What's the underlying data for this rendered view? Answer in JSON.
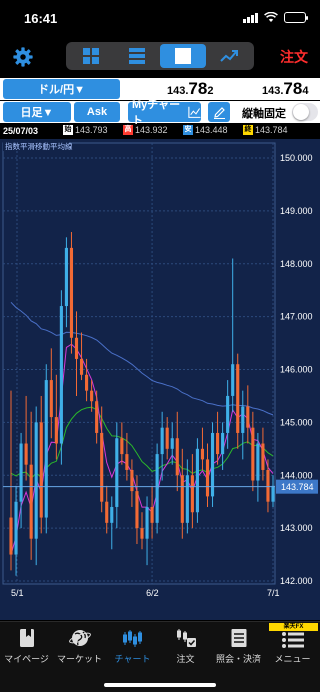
{
  "status": {
    "time": "16:41"
  },
  "toolbar": {
    "order_label": "注文"
  },
  "quote": {
    "pair_label": "ドル/円▼",
    "bid": {
      "main": "143.",
      "big": "78",
      "tail": "2"
    },
    "ask": {
      "main": "143.",
      "big": "78",
      "tail": "4"
    }
  },
  "controls": {
    "timeframe_label": "日足▼",
    "side_label": "Ask",
    "mychart_label": "Myチャート",
    "fix_axis_label": "縦軸固定"
  },
  "ohlc": {
    "date": "25/07/03",
    "open_tag": "始",
    "open": "143.793",
    "high_tag": "高",
    "high": "143.932",
    "low_tag": "安",
    "low": "143.448",
    "close_tag": "終",
    "close": "143.784"
  },
  "chart_data": {
    "type": "candlestick",
    "indicator_label": "指数平滑移動平均線",
    "y_ticks": [
      "150.000",
      "149.000",
      "148.000",
      "147.000",
      "146.000",
      "145.000",
      "144.000",
      "143.000",
      "142.000"
    ],
    "ylim": [
      142.0,
      150.0
    ],
    "x_ticks": [
      "5/1",
      "6/2",
      "7/1"
    ],
    "current_price_label": "143.784",
    "current_price": 143.784,
    "colors": {
      "up": "#3fb0e8",
      "down": "#f26a35",
      "ema_short": "#d838d8",
      "ema_mid": "#2bb82b",
      "ema_long": "#4a70c8"
    },
    "candles": [
      [
        143.2,
        145.6,
        142.2,
        142.5
      ],
      [
        142.5,
        143.8,
        142.1,
        143.5
      ],
      [
        143.5,
        144.8,
        143.0,
        144.6
      ],
      [
        144.6,
        145.5,
        143.9,
        144.2
      ],
      [
        144.2,
        145.2,
        142.4,
        142.8
      ],
      [
        142.8,
        145.3,
        142.3,
        145.0
      ],
      [
        145.0,
        145.5,
        142.9,
        143.2
      ],
      [
        143.2,
        146.1,
        142.9,
        145.8
      ],
      [
        145.8,
        146.4,
        144.7,
        145.1
      ],
      [
        145.1,
        145.9,
        144.3,
        144.6
      ],
      [
        144.6,
        147.5,
        144.2,
        147.2
      ],
      [
        147.2,
        148.5,
        146.8,
        148.3
      ],
      [
        148.3,
        148.6,
        146.3,
        146.6
      ],
      [
        146.6,
        147.1,
        145.5,
        146.2
      ],
      [
        146.2,
        146.7,
        145.8,
        145.9
      ],
      [
        145.9,
        146.2,
        145.4,
        145.6
      ],
      [
        145.6,
        145.8,
        145.2,
        145.4
      ],
      [
        145.4,
        145.6,
        144.6,
        144.8
      ],
      [
        144.8,
        145.3,
        143.3,
        143.5
      ],
      [
        143.5,
        143.8,
        142.9,
        143.1
      ],
      [
        143.1,
        143.6,
        142.6,
        143.4
      ],
      [
        143.4,
        145.0,
        143.0,
        144.7
      ],
      [
        144.7,
        145.0,
        144.2,
        144.4
      ],
      [
        144.4,
        144.8,
        143.9,
        144.1
      ],
      [
        144.1,
        144.3,
        143.4,
        143.7
      ],
      [
        143.7,
        144.0,
        142.7,
        143.0
      ],
      [
        143.0,
        143.3,
        142.6,
        142.8
      ],
      [
        142.8,
        143.6,
        142.3,
        143.4
      ],
      [
        143.4,
        143.8,
        142.8,
        143.1
      ],
      [
        143.1,
        144.6,
        142.9,
        144.4
      ],
      [
        144.4,
        145.2,
        143.9,
        144.9
      ],
      [
        144.9,
        145.1,
        144.3,
        144.5
      ],
      [
        144.5,
        145.0,
        144.2,
        144.7
      ],
      [
        144.7,
        145.2,
        143.7,
        144.0
      ],
      [
        144.0,
        144.5,
        142.8,
        143.1
      ],
      [
        143.1,
        144.3,
        142.9,
        144.0
      ],
      [
        144.0,
        144.4,
        143.0,
        143.3
      ],
      [
        143.3,
        144.7,
        143.1,
        144.5
      ],
      [
        144.5,
        144.9,
        144.1,
        144.3
      ],
      [
        144.3,
        144.6,
        143.4,
        143.6
      ],
      [
        143.6,
        145.0,
        143.4,
        144.8
      ],
      [
        144.8,
        145.2,
        144.2,
        144.4
      ],
      [
        144.4,
        145.0,
        144.1,
        144.8
      ],
      [
        144.8,
        145.8,
        144.5,
        145.5
      ],
      [
        145.5,
        148.1,
        145.2,
        146.1
      ],
      [
        146.1,
        146.3,
        144.5,
        144.8
      ],
      [
        144.8,
        145.6,
        144.3,
        145.3
      ],
      [
        145.3,
        145.7,
        144.6,
        144.9
      ],
      [
        144.9,
        145.2,
        143.7,
        143.9
      ],
      [
        143.9,
        144.8,
        143.5,
        144.6
      ],
      [
        144.6,
        144.9,
        143.9,
        144.1
      ],
      [
        144.1,
        144.3,
        143.3,
        143.5
      ],
      [
        143.5,
        144.0,
        143.4,
        143.8
      ]
    ]
  },
  "nav": {
    "brand": "楽天FX",
    "items": [
      {
        "label": "マイページ"
      },
      {
        "label": "マーケット"
      },
      {
        "label": "チャート"
      },
      {
        "label": "注文"
      },
      {
        "label": "照会・決済"
      },
      {
        "label": "メニュー"
      }
    ]
  }
}
